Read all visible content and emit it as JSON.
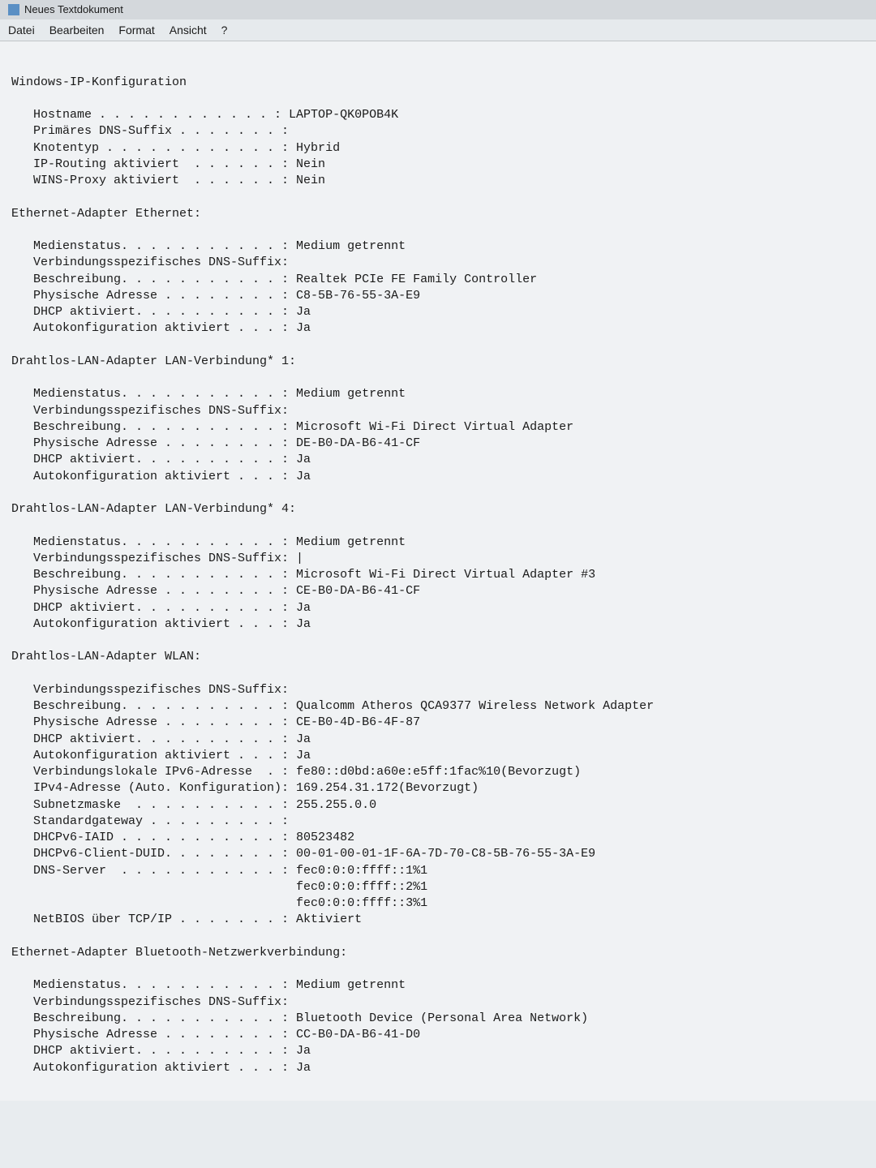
{
  "window": {
    "title": "Neues Textdokument"
  },
  "menu": {
    "file": "Datei",
    "edit": "Bearbeiten",
    "format": "Format",
    "view": "Ansicht",
    "help": "?"
  },
  "ipconfig": {
    "header": "Windows-IP-Konfiguration",
    "main": [
      {
        "label": "Hostname",
        "dots": " . . . . . . . . . . . . ",
        "value": "LAPTOP-QK0POB4K"
      },
      {
        "label": "Primäres DNS-Suffix",
        "dots": " . . . . . . . ",
        "value": ""
      },
      {
        "label": "Knotentyp",
        "dots": " . . . . . . . . . . . . ",
        "value": "Hybrid"
      },
      {
        "label": "IP-Routing aktiviert",
        "dots": "  . . . . . . ",
        "value": "Nein"
      },
      {
        "label": "WINS-Proxy aktiviert",
        "dots": "  . . . . . . ",
        "value": "Nein"
      }
    ],
    "adapters": [
      {
        "title": "Ethernet-Adapter Ethernet:",
        "rows": [
          {
            "label": "Medienstatus",
            "dots": ". . . . . . . . . . . ",
            "value": "Medium getrennt"
          },
          {
            "label": "Verbindungsspezifisches DNS-Suffix",
            "dots": "",
            "value": ""
          },
          {
            "label": "Beschreibung",
            "dots": ". . . . . . . . . . . ",
            "value": "Realtek PCIe FE Family Controller"
          },
          {
            "label": "Physische Adresse",
            "dots": " . . . . . . . . ",
            "value": "C8-5B-76-55-3A-E9"
          },
          {
            "label": "DHCP aktiviert",
            "dots": ". . . . . . . . . . ",
            "value": "Ja"
          },
          {
            "label": "Autokonfiguration aktiviert",
            "dots": " . . . ",
            "value": "Ja"
          }
        ]
      },
      {
        "title": "Drahtlos-LAN-Adapter LAN-Verbindung* 1:",
        "rows": [
          {
            "label": "Medienstatus",
            "dots": ". . . . . . . . . . . ",
            "value": "Medium getrennt"
          },
          {
            "label": "Verbindungsspezifisches DNS-Suffix",
            "dots": "",
            "value": ""
          },
          {
            "label": "Beschreibung",
            "dots": ". . . . . . . . . . . ",
            "value": "Microsoft Wi-Fi Direct Virtual Adapter"
          },
          {
            "label": "Physische Adresse",
            "dots": " . . . . . . . . ",
            "value": "DE-B0-DA-B6-41-CF"
          },
          {
            "label": "DHCP aktiviert",
            "dots": ". . . . . . . . . . ",
            "value": "Ja"
          },
          {
            "label": "Autokonfiguration aktiviert",
            "dots": " . . . ",
            "value": "Ja"
          }
        ]
      },
      {
        "title": "Drahtlos-LAN-Adapter LAN-Verbindung* 4:",
        "rows": [
          {
            "label": "Medienstatus",
            "dots": ". . . . . . . . . . . ",
            "value": "Medium getrennt"
          },
          {
            "label": "Verbindungsspezifisches DNS-Suffix",
            "dots": "",
            "value": "|"
          },
          {
            "label": "Beschreibung",
            "dots": ". . . . . . . . . . . ",
            "value": "Microsoft Wi-Fi Direct Virtual Adapter #3"
          },
          {
            "label": "Physische Adresse",
            "dots": " . . . . . . . . ",
            "value": "CE-B0-DA-B6-41-CF"
          },
          {
            "label": "DHCP aktiviert",
            "dots": ". . . . . . . . . . ",
            "value": "Ja"
          },
          {
            "label": "Autokonfiguration aktiviert",
            "dots": " . . . ",
            "value": "Ja"
          }
        ]
      },
      {
        "title": "Drahtlos-LAN-Adapter WLAN:",
        "rows": [
          {
            "label": "Verbindungsspezifisches DNS-Suffix",
            "dots": "",
            "value": ""
          },
          {
            "label": "Beschreibung",
            "dots": ". . . . . . . . . . . ",
            "value": "Qualcomm Atheros QCA9377 Wireless Network Adapter"
          },
          {
            "label": "Physische Adresse",
            "dots": " . . . . . . . . ",
            "value": "CE-B0-4D-B6-4F-87"
          },
          {
            "label": "DHCP aktiviert",
            "dots": ". . . . . . . . . . ",
            "value": "Ja"
          },
          {
            "label": "Autokonfiguration aktiviert",
            "dots": " . . . ",
            "value": "Ja"
          },
          {
            "label": "Verbindungslokale IPv6-Adresse ",
            "dots": " . ",
            "value": "fe80::d0bd:a60e:e5ff:1fac%10(Bevorzugt)"
          },
          {
            "label": "IPv4-Adresse (Auto. Konfiguration)",
            "dots": "",
            "value": "169.254.31.172(Bevorzugt)"
          },
          {
            "label": "Subnetzmaske ",
            "dots": " . . . . . . . . . . ",
            "value": "255.255.0.0"
          },
          {
            "label": "Standardgateway",
            "dots": " . . . . . . . . . ",
            "value": ""
          },
          {
            "label": "DHCPv6-IAID",
            "dots": " . . . . . . . . . . . ",
            "value": "80523482"
          },
          {
            "label": "DHCPv6-Client-DUID",
            "dots": ". . . . . . . . ",
            "value": "00-01-00-01-1F-6A-7D-70-C8-5B-76-55-3A-E9"
          },
          {
            "label": "DNS-Server ",
            "dots": " . . . . . . . . . . . ",
            "value": "fec0:0:0:ffff::1%1"
          }
        ],
        "extra": [
          "fec0:0:0:ffff::2%1",
          "fec0:0:0:ffff::3%1"
        ],
        "tail": [
          {
            "label": "NetBIOS über TCP/IP",
            "dots": " . . . . . . . ",
            "value": "Aktiviert"
          }
        ]
      },
      {
        "title": "Ethernet-Adapter Bluetooth-Netzwerkverbindung:",
        "rows": [
          {
            "label": "Medienstatus",
            "dots": ". . . . . . . . . . . ",
            "value": "Medium getrennt"
          },
          {
            "label": "Verbindungsspezifisches DNS-Suffix",
            "dots": "",
            "value": ""
          },
          {
            "label": "Beschreibung",
            "dots": ". . . . . . . . . . . ",
            "value": "Bluetooth Device (Personal Area Network)"
          },
          {
            "label": "Physische Adresse",
            "dots": " . . . . . . . . ",
            "value": "CC-B0-DA-B6-41-D0"
          },
          {
            "label": "DHCP aktiviert",
            "dots": ". . . . . . . . . . ",
            "value": "Ja"
          },
          {
            "label": "Autokonfiguration aktiviert",
            "dots": " . . . ",
            "value": "Ja"
          }
        ]
      }
    ]
  }
}
